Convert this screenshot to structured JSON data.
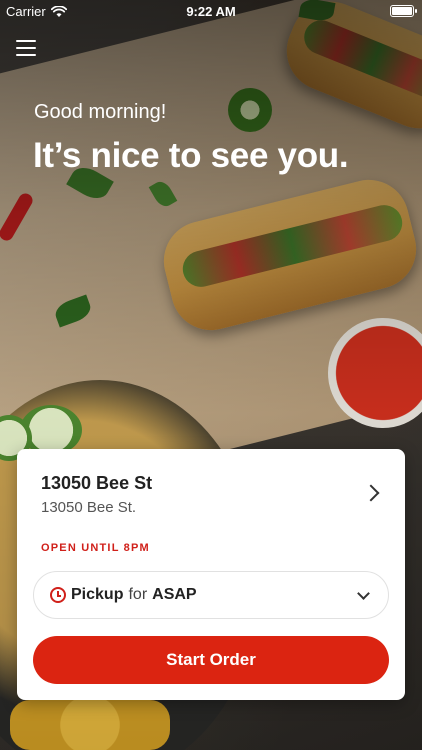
{
  "status_bar": {
    "carrier": "Carrier",
    "time": "9:22 AM",
    "wifi_icon": "wifi-icon",
    "battery_icon": "battery-icon"
  },
  "header": {
    "menu_icon": "hamburger-menu-icon",
    "greeting": "Good morning!",
    "headline": "It’s nice to see you."
  },
  "location_card": {
    "name": "13050 Bee St",
    "address": "13050 Bee St.",
    "hours": "OPEN UNTIL 8PM",
    "pickup": {
      "mode": "Pickup",
      "connector": "for",
      "when": "ASAP"
    },
    "start_order_label": "Start Order"
  },
  "colors": {
    "accent": "#db2411",
    "hours_text": "#d0201a",
    "card_bg": "#ffffff"
  }
}
